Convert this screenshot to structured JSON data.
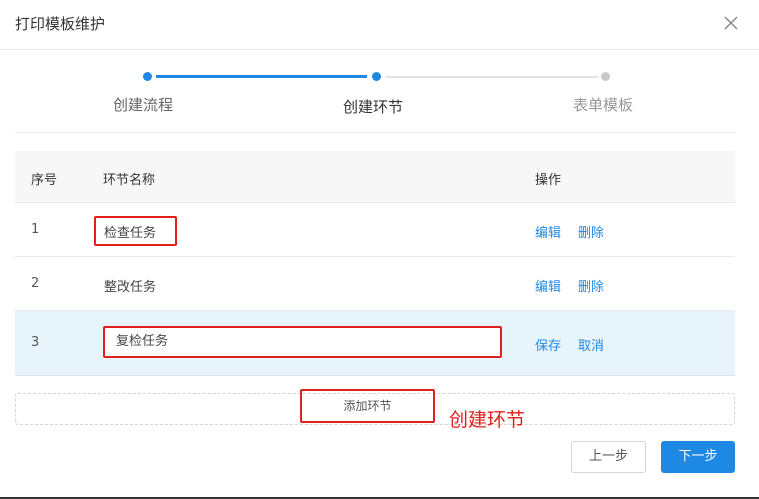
{
  "dialog": {
    "title": "打印模板维护",
    "close_icon": "close-icon"
  },
  "steps": [
    {
      "label": "创建流程",
      "status": "done"
    },
    {
      "label": "创建环节",
      "status": "active"
    },
    {
      "label": "表单模板",
      "status": "pending"
    }
  ],
  "table": {
    "headers": {
      "index": "序号",
      "name": "环节名称",
      "actions": "操作"
    },
    "rows": [
      {
        "index": "1",
        "name": "检查任务",
        "action_a": "编辑",
        "action_b": "删除"
      },
      {
        "index": "2",
        "name": "整改任务",
        "action_a": "编辑",
        "action_b": "删除"
      },
      {
        "index": "3",
        "name": "复检任务",
        "action_a": "保存",
        "action_b": "取消"
      }
    ]
  },
  "add_step_label": "添加环节",
  "annotation_text": "创建环节",
  "footer": {
    "prev_label": "上一步",
    "next_label": "下一步"
  },
  "colors": {
    "primary": "#1e88e5",
    "highlight": "#e0201a",
    "editing_row": "#e8f4fb"
  }
}
